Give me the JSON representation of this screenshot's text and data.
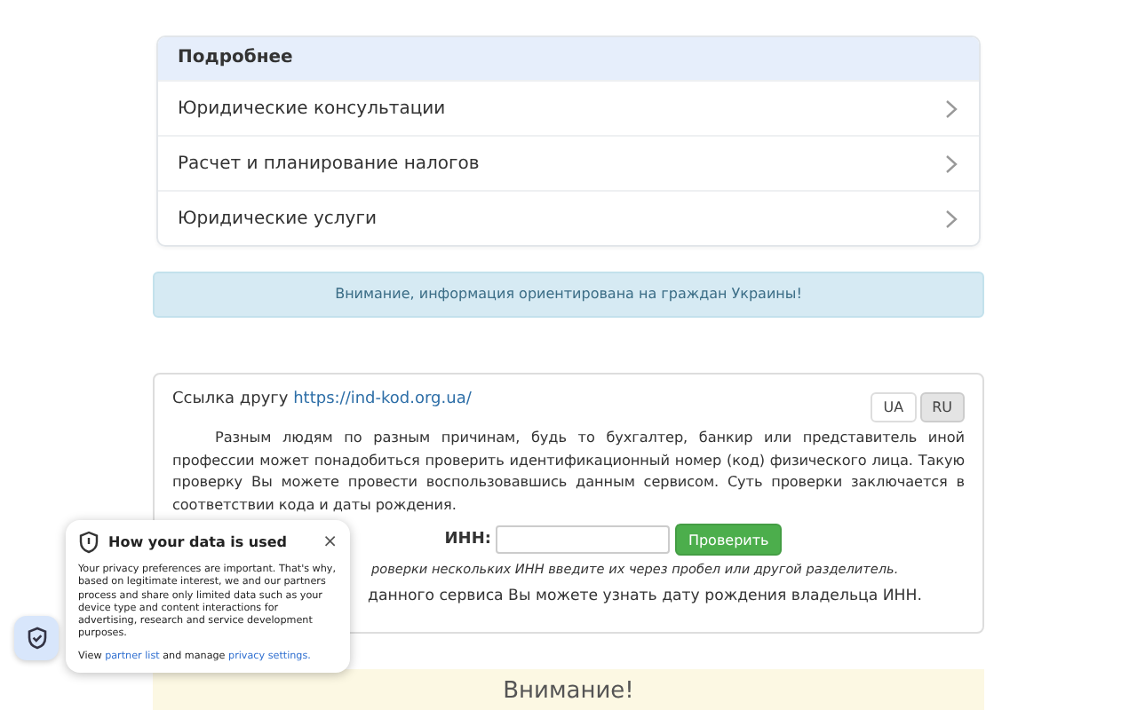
{
  "menu": {
    "title": "Подробнее",
    "items": [
      {
        "label": "Юридические консультации"
      },
      {
        "label": "Расчет и планирование налогов"
      },
      {
        "label": "Юридические услуги"
      }
    ]
  },
  "notice": "Внимание, информация ориентирована на граждан Украины!",
  "form": {
    "share_label": "Ссылка другу",
    "share_link": "https://ind-kod.org.ua/",
    "languages": [
      {
        "label": "UA",
        "selected": false
      },
      {
        "label": "RU",
        "selected": true
      }
    ],
    "intro": "Разным людям по разным причинам, будь то бухгалтер, банкир или представитель иной профессии может понадобиться проверить идентификационный номер (код) физического лица. Такую проверку Вы можете провести воспользовавшись данным сервисом. Суть проверки заключается в соответствии кода и даты рождения.",
    "inn_label": "ИНН:",
    "check_button": "Проверить",
    "hint": "роверки нескольких ИНН введите их через пробел или другой разделитель.",
    "note": "данного сервиса Вы можете узнать дату рождения владельца ИНН."
  },
  "warning_title": "Внимание!",
  "privacy": {
    "title": "How your data is used",
    "close": "×",
    "body": "Your privacy preferences are important. That's why, based on legitimate interest, we and our partners process and share only limited data such as your device type and content interactions for advertising, research and service development purposes.",
    "view": "View",
    "partner_link": "partner list",
    "and_manage": "and manage",
    "settings_link": "privacy settings."
  }
}
